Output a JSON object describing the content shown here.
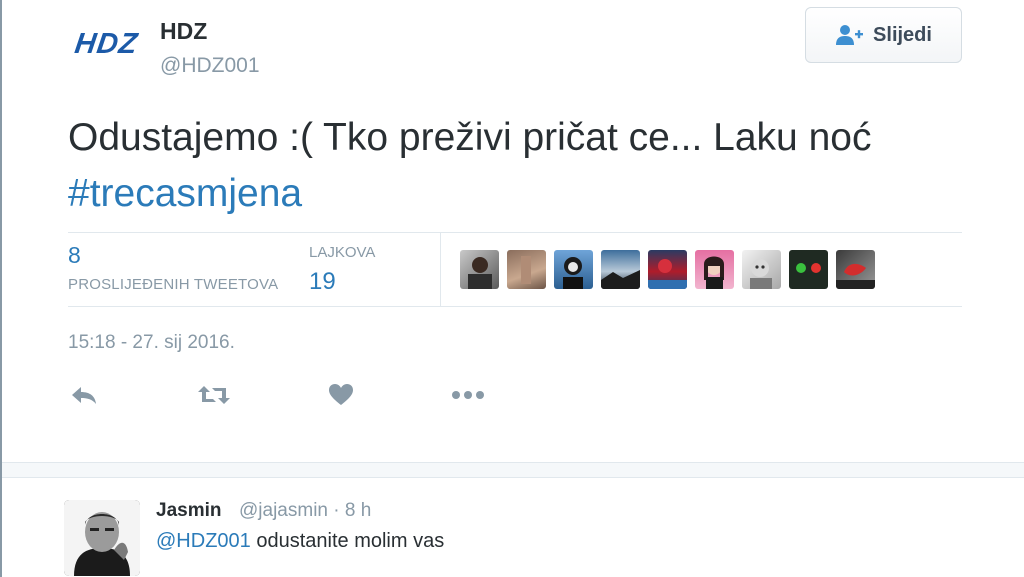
{
  "author": {
    "name": "HDZ",
    "handle": "@HDZ001",
    "logo_text": "HDZ"
  },
  "follow_button": {
    "label": "Slijedi"
  },
  "tweet": {
    "text_main": "Odustajemo :( Tko preživi pričat ce... Laku noć ",
    "hashtag": "#trecasmjena"
  },
  "stats": {
    "retweets_count": "8",
    "retweets_label": "PROSLIJEĐENIH TWEETOVA",
    "likes_label": "LAJKOVA",
    "likes_count": "19"
  },
  "likers_count_shown": 9,
  "timestamp": "15:18 - 27. sij 2016.",
  "actions": [
    "reply-icon",
    "retweet-icon",
    "like-icon",
    "more-icon"
  ],
  "reply": {
    "name": "Jasmin",
    "handle_time": "@jajasmin · 8 h",
    "mention": "@HDZ001",
    "text": " odustanite molim vas"
  },
  "colors": {
    "link": "#2b7bb9",
    "muted": "#8899a6",
    "text": "#292f33",
    "logo": "#1c5aa8"
  }
}
